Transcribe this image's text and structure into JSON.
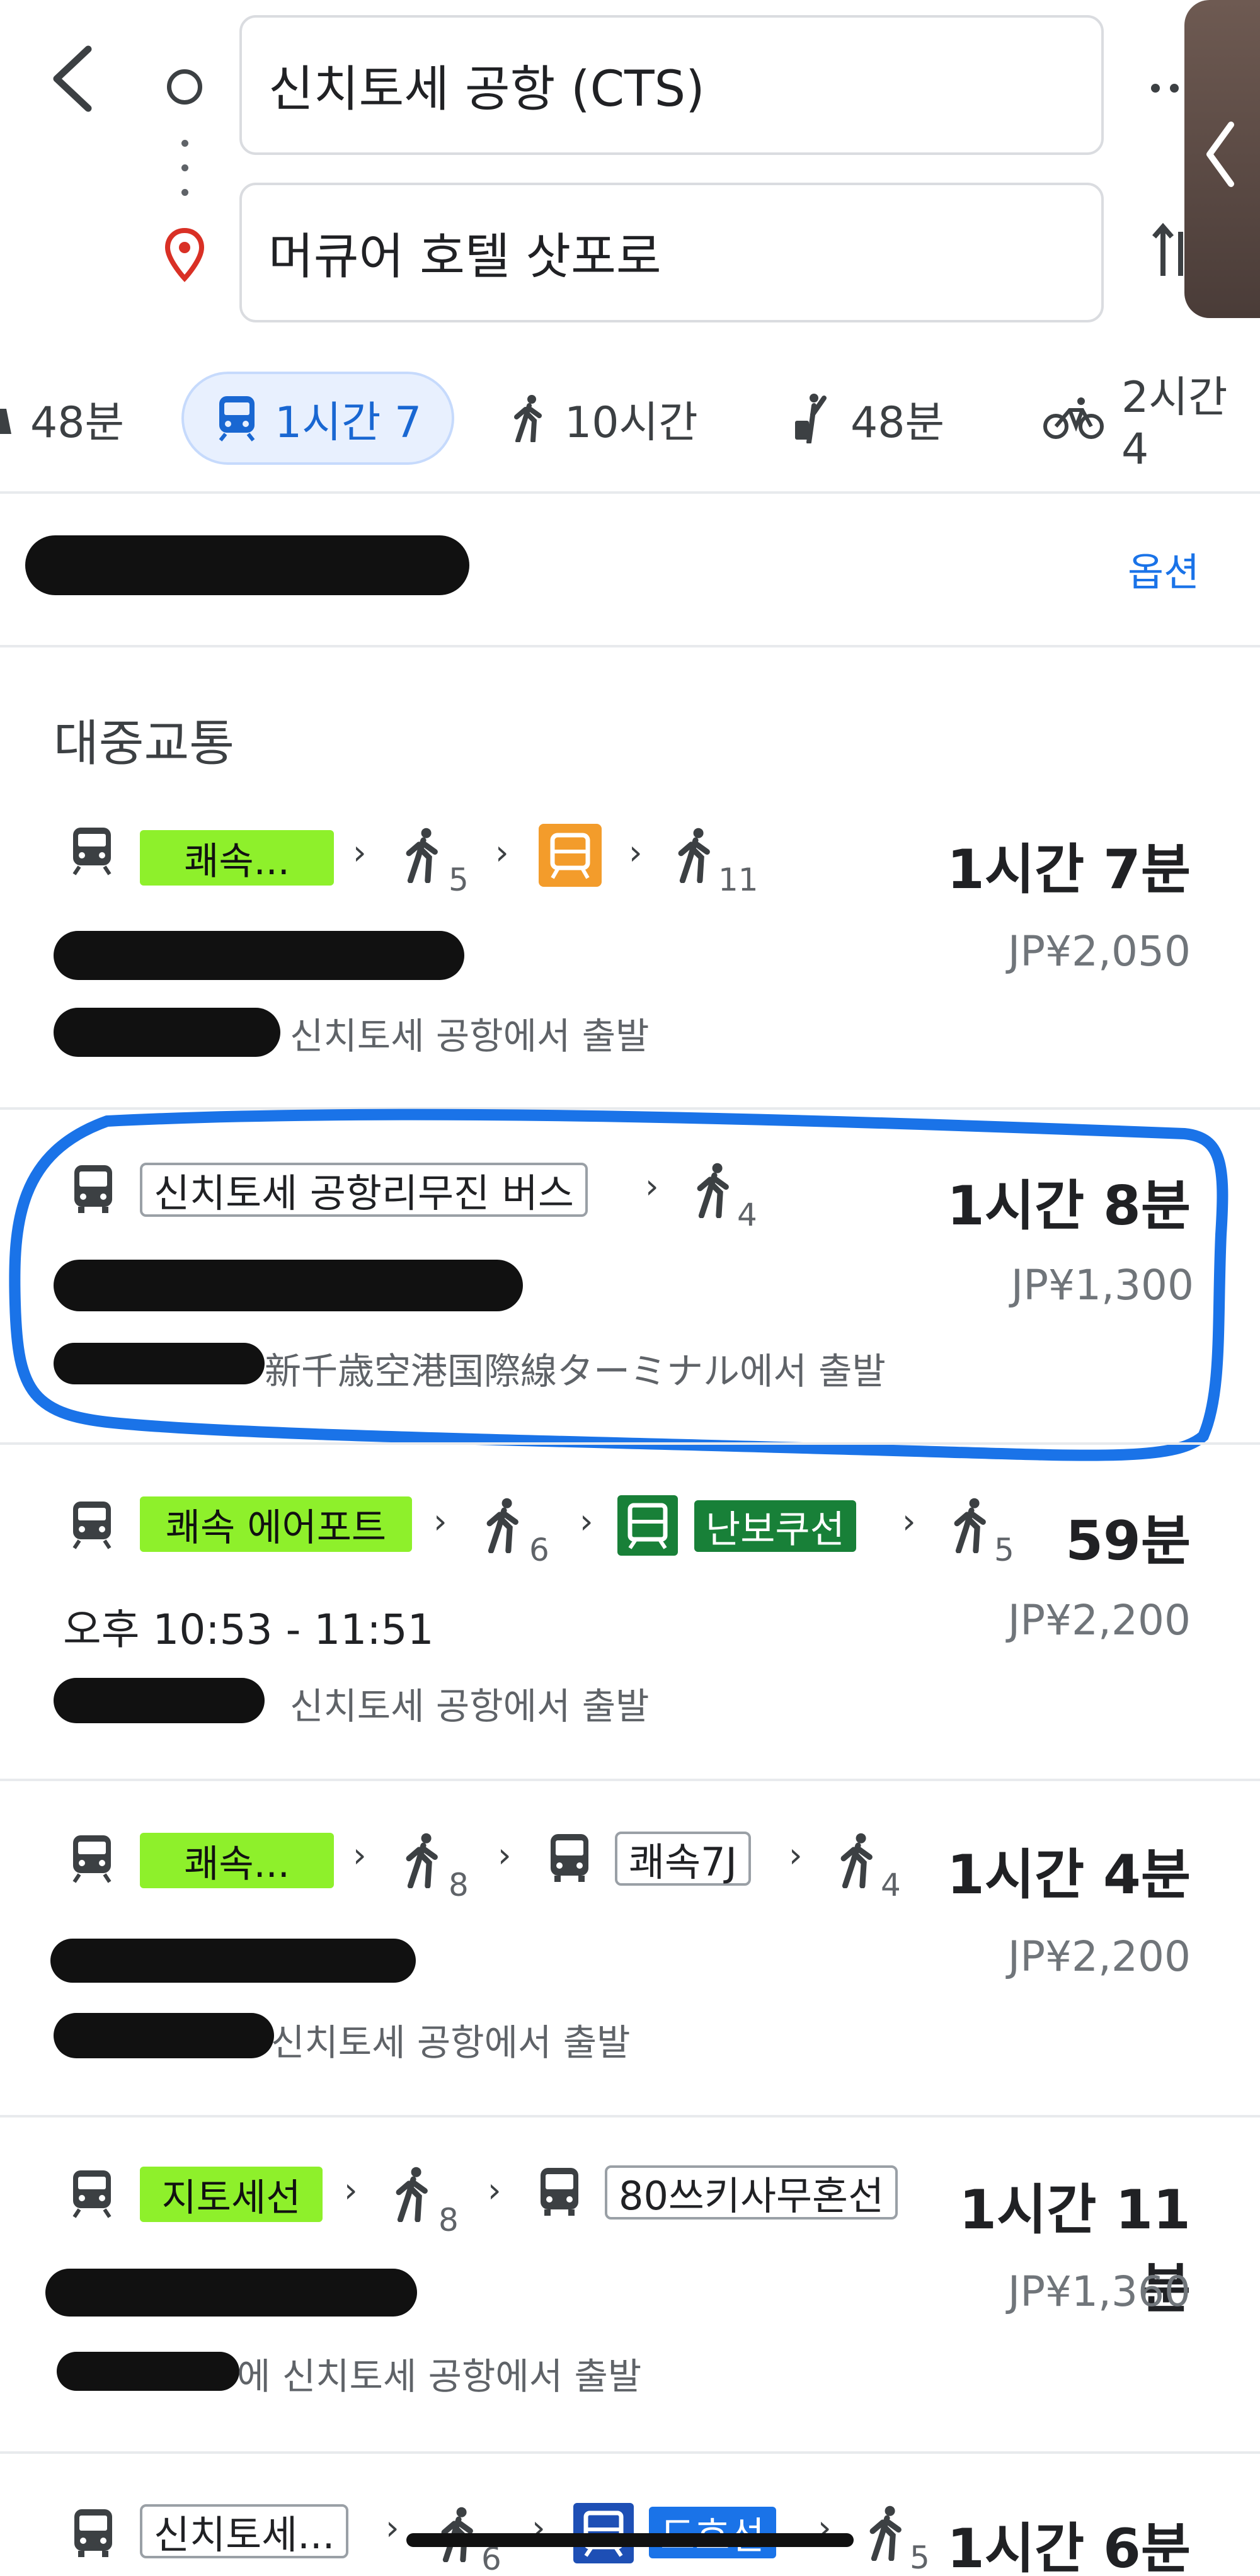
{
  "search": {
    "origin": "신치토세 공항 (CTS)",
    "destination": "머큐어 호텔 삿포로"
  },
  "modes": [
    {
      "icon": "car-icon",
      "label": "48분"
    },
    {
      "icon": "train-icon",
      "label": "1시간 7",
      "selected": true
    },
    {
      "icon": "walk-icon",
      "label": "10시간"
    },
    {
      "icon": "rideshare-icon",
      "label": "48분"
    },
    {
      "icon": "bike-icon",
      "label": "2시간 4"
    }
  ],
  "options_label": "옵션",
  "section_title": "대중교통",
  "routes": [
    {
      "segments": [
        "train-icon",
        {
          "chip": "쾌속..."
        },
        "chevron",
        {
          "walk": "5"
        },
        "chevron",
        "tram-orange-icon",
        "chevron",
        {
          "walk": "11"
        }
      ],
      "duration": "1시간 7분",
      "fare": "JP¥2,050",
      "departure": "신치토세 공항에서 출발"
    },
    {
      "segments": [
        "bus-icon",
        {
          "outline": "신치토세 공항리무진 버스"
        },
        "chevron",
        {
          "walk": "4"
        }
      ],
      "duration": "1시간 8분",
      "fare": "JP¥1,300",
      "departure": "新千歳空港国際線ターミナル에서 출발"
    },
    {
      "segments": [
        "train-icon",
        {
          "chip": "쾌속 에어포트"
        },
        "chevron",
        {
          "walk": "6"
        },
        "chevron",
        "subway-green-icon",
        {
          "chip_dark": "난보쿠선"
        },
        "chevron",
        {
          "walk": "5"
        }
      ],
      "duration": "59분",
      "fare": "JP¥2,200",
      "times": "오후 10:53 - 11:51",
      "departure": "신치토세 공항에서 출발"
    },
    {
      "segments": [
        "train-icon",
        {
          "chip": "쾌속..."
        },
        "chevron",
        {
          "walk": "8"
        },
        "chevron",
        "bus-icon",
        {
          "outline": "쾌속7J"
        },
        "chevron",
        {
          "walk": "4"
        }
      ],
      "duration": "1시간 4분",
      "fare": "JP¥2,200",
      "departure": "신치토세 공항에서 출발"
    },
    {
      "segments": [
        "train-icon",
        {
          "chip": "지토세선"
        },
        "chevron",
        {
          "walk": "8"
        },
        "chevron",
        "bus-icon",
        {
          "outline": "80쓰키사무혼선"
        }
      ],
      "duration": "1시간 11분",
      "fare": "JP¥1,360",
      "departure": "에 신치토세 공항에서 출발"
    },
    {
      "segments": [
        "bus-icon",
        {
          "outline": "신치토세..."
        },
        "chevron",
        {
          "walk": "6"
        },
        "chevron",
        "subway-blue-icon",
        {
          "chip_blue": "도호선"
        },
        "chevron",
        {
          "walk": "5"
        }
      ],
      "duration": "1시간 6분"
    }
  ],
  "colors": {
    "accent": "#1a73e8",
    "selected_tab_bg": "#e8f0fe",
    "rapid_chip": "#8ef02b",
    "namboku_line": "#188038",
    "toho_line": "#1e4fb5",
    "highlight_stroke": "#1a73e8",
    "tram": "#f39c2b"
  }
}
